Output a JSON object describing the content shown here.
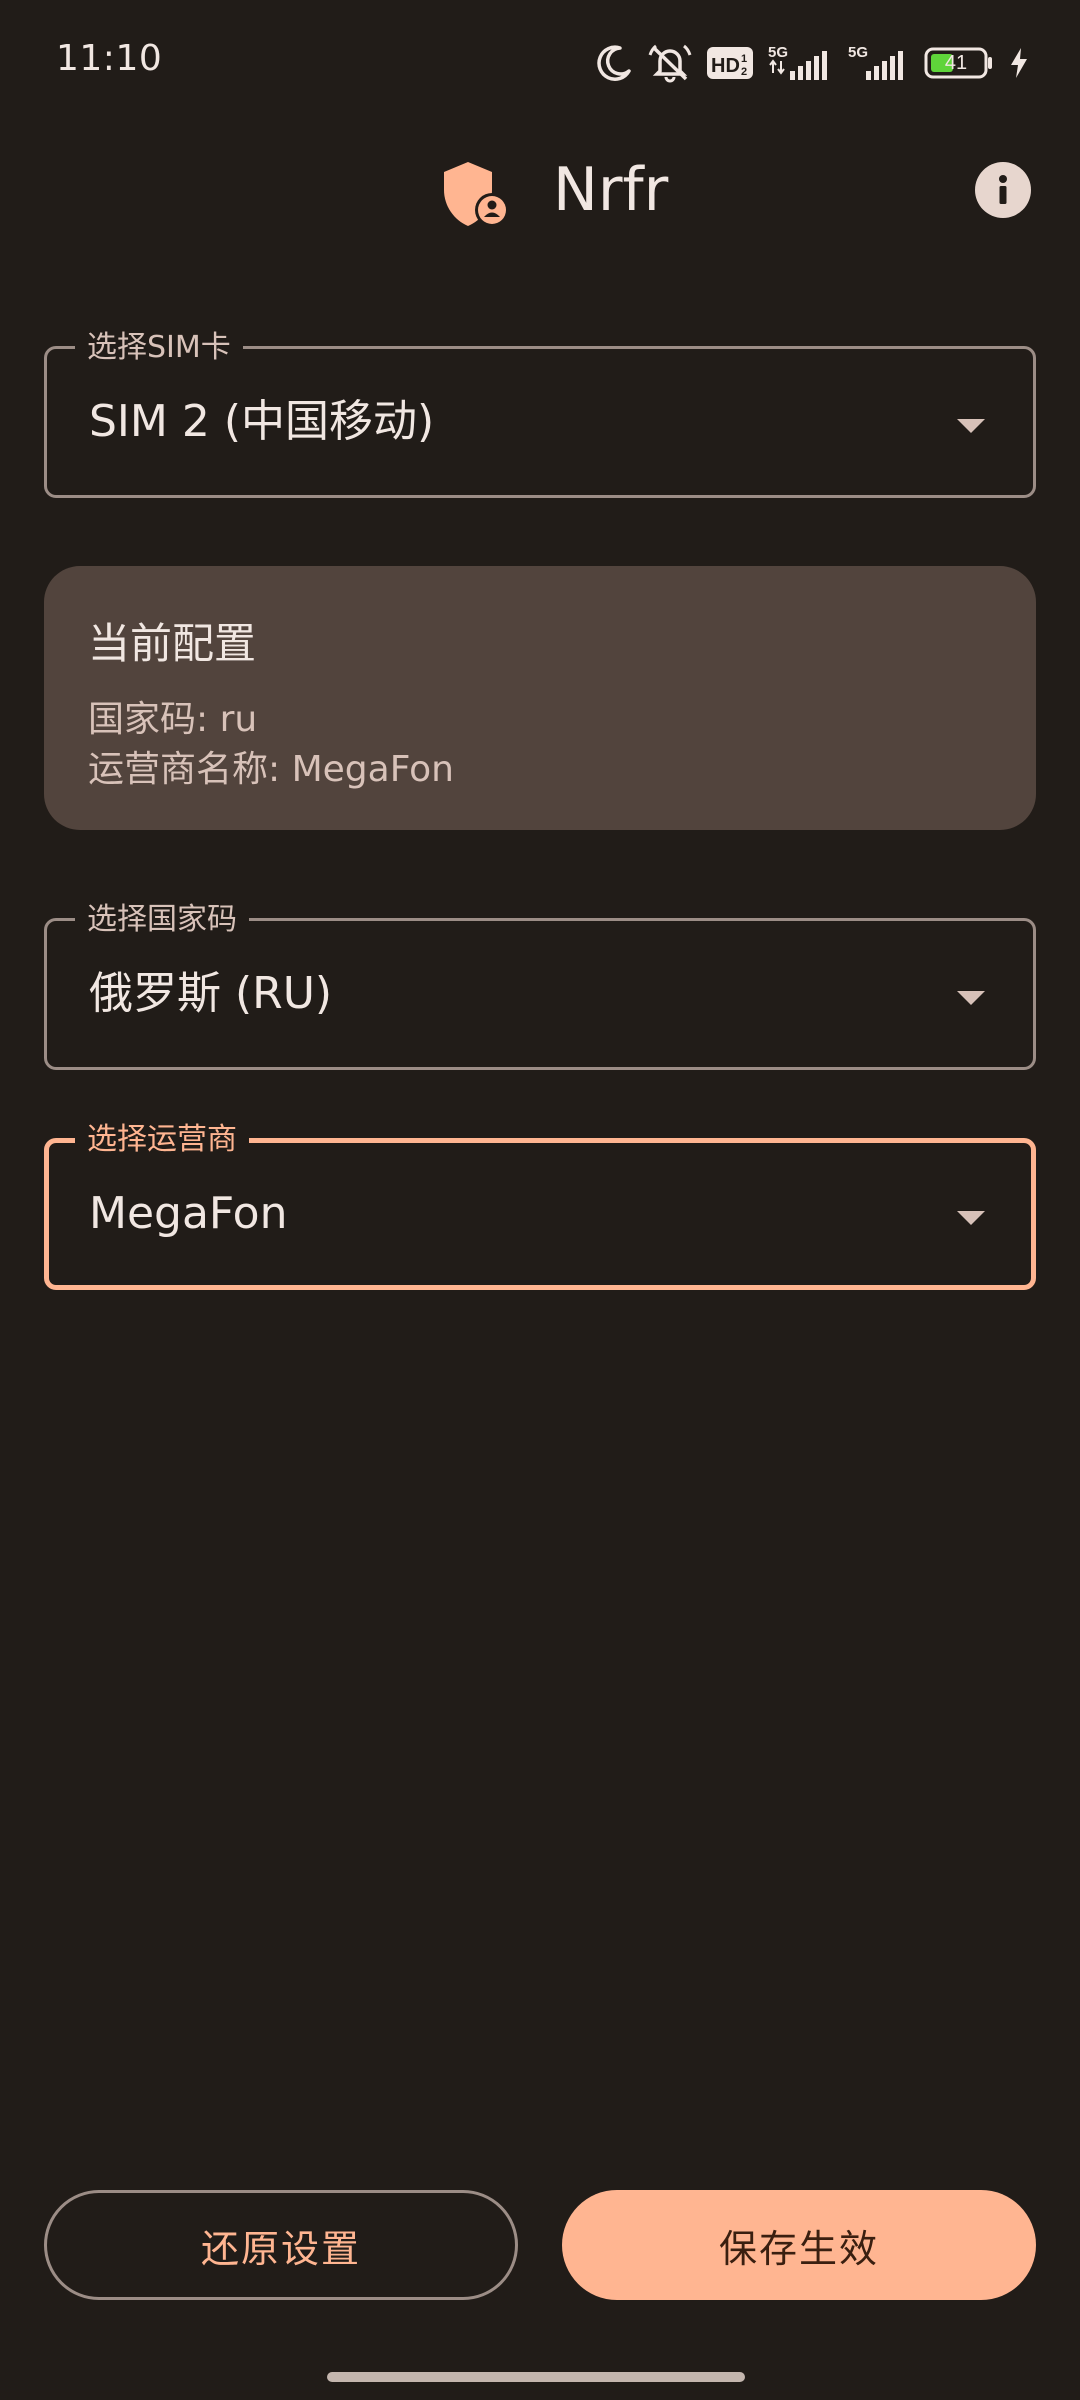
{
  "status_bar": {
    "time": "11:10",
    "battery_level": "41",
    "network_1": "5G",
    "network_2": "5G",
    "hd_badge": "HD"
  },
  "app_bar": {
    "title": "Nrfr",
    "logo_icon": "shield-person-icon",
    "info_icon": "info-icon"
  },
  "sim_select": {
    "label": "选择SIM卡",
    "value": "SIM 2 (中国移动)"
  },
  "current_config": {
    "title": "当前配置",
    "country_code_line": "国家码: ru",
    "carrier_name_line": "运营商名称: MegaFon"
  },
  "country_select": {
    "label": "选择国家码",
    "value": "俄罗斯 (RU)"
  },
  "carrier_select": {
    "label": "选择运营商",
    "value": "MegaFon"
  },
  "actions": {
    "reset_label": "还原设置",
    "save_label": "保存生效"
  },
  "colors": {
    "background": "#211c18",
    "accent": "#ffb591",
    "card": "#52443d",
    "outline": "#9c8d86"
  }
}
